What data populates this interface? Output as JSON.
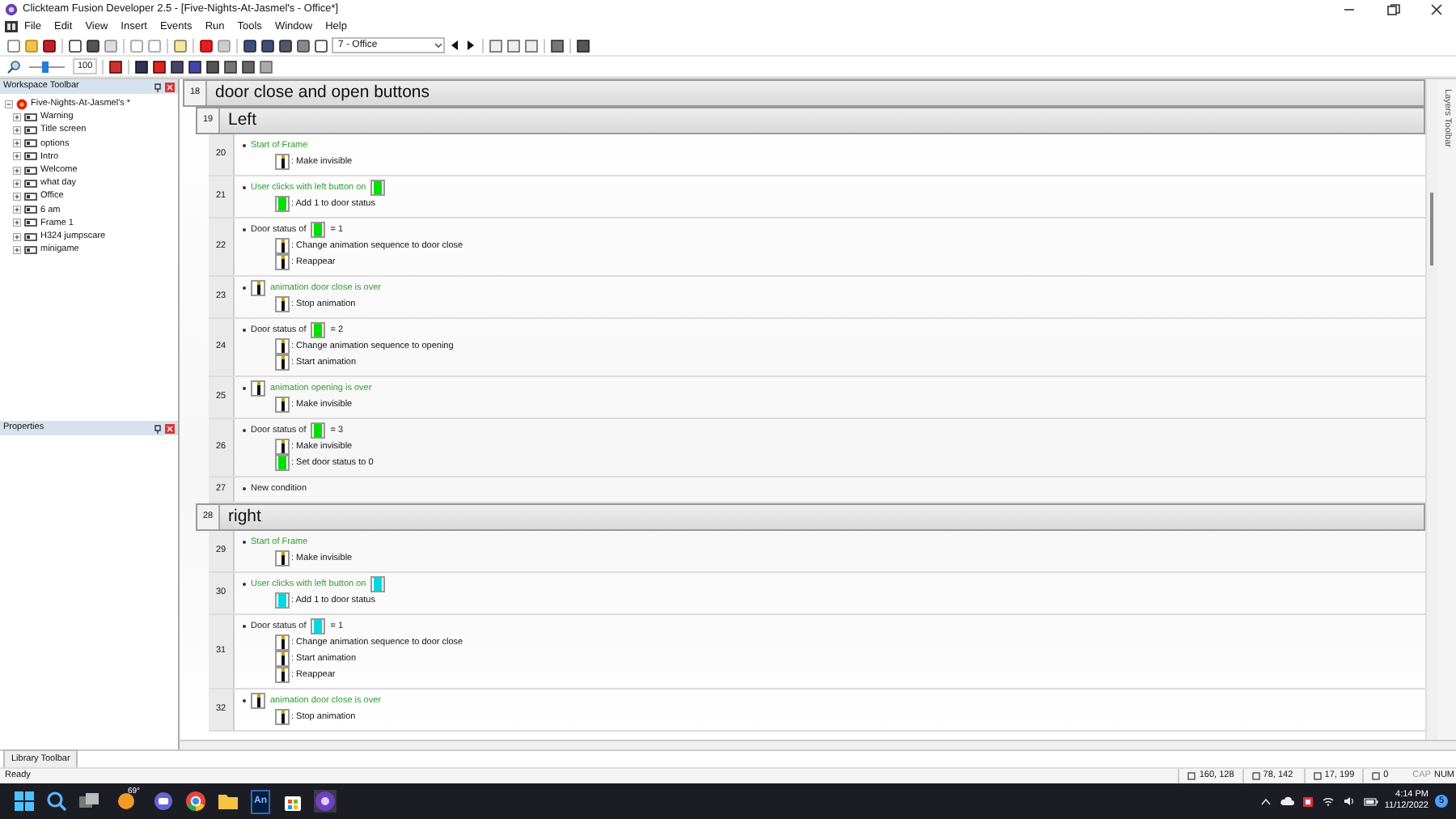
{
  "window": {
    "title": "Clickteam Fusion Developer 2.5 - [Five-Nights-At-Jasmel's - Office*]"
  },
  "menu": [
    "File",
    "Edit",
    "View",
    "Insert",
    "Events",
    "Run",
    "Tools",
    "Window",
    "Help"
  ],
  "toolbar": {
    "frame_select": "7 - Office",
    "zoom": "100",
    "slider": {
      "level": 0.45
    }
  },
  "workspace": {
    "title": "Workspace Toolbar",
    "project": {
      "label": "Five-Nights-At-Jasmel's *",
      "expanded": true,
      "children": [
        {
          "label": "Warning"
        },
        {
          "label": "Title screen"
        },
        {
          "label": "options"
        },
        {
          "label": "Intro"
        },
        {
          "label": "Welcome"
        },
        {
          "label": "what day"
        },
        {
          "label": "Office"
        },
        {
          "label": "6 am"
        },
        {
          "label": "Frame 1"
        },
        {
          "label": "H324 jumpscare"
        },
        {
          "label": "minigame"
        }
      ]
    }
  },
  "properties": {
    "title": "Properties"
  },
  "events": [
    {
      "kind": "group",
      "number": "18",
      "title": "door close and open buttons",
      "children": [
        {
          "kind": "group",
          "number": "19",
          "title": "Left",
          "children": [
            {
              "kind": "event",
              "number": "20",
              "condition": {
                "color": "#2e9e2e",
                "parts": [
                  {
                    "kind": "text",
                    "text": "Start of Frame"
                  }
                ]
              },
              "actions": [
                {
                  "kind": "door",
                  "text": ": Make invisible"
                }
              ]
            },
            {
              "kind": "event",
              "number": "21",
              "condition": {
                "color": "#2e9e2e",
                "parts": [
                  {
                    "kind": "text",
                    "text": "User clicks with left button on"
                  },
                  {
                    "kind": "button",
                    "color": "#00e000"
                  }
                ]
              },
              "actions": [
                {
                  "kind": "button",
                  "color": "#00e000",
                  "text": ": Add 1 to door status"
                }
              ]
            },
            {
              "kind": "event",
              "number": "22",
              "condition": {
                "color": "#222222",
                "parts": [
                  {
                    "kind": "text",
                    "text": "Door status of"
                  },
                  {
                    "kind": "button",
                    "color": "#00e000"
                  },
                  {
                    "kind": "text",
                    "text": "= 1"
                  }
                ]
              },
              "actions": [
                {
                  "kind": "door",
                  "text": ": Change animation sequence to door close"
                },
                {
                  "kind": "door",
                  "text": ": Reappear"
                }
              ]
            },
            {
              "kind": "event",
              "number": "23",
              "condition": {
                "color": "#2e9e2e",
                "parts": [
                  {
                    "kind": "door"
                  },
                  {
                    "kind": "text",
                    "text": "animation door close is over"
                  }
                ]
              },
              "actions": [
                {
                  "kind": "door",
                  "text": ": Stop animation"
                }
              ]
            },
            {
              "kind": "event",
              "number": "24",
              "condition": {
                "color": "#222222",
                "parts": [
                  {
                    "kind": "text",
                    "text": "Door status of"
                  },
                  {
                    "kind": "button",
                    "color": "#00e000"
                  },
                  {
                    "kind": "text",
                    "text": "= 2"
                  }
                ]
              },
              "actions": [
                {
                  "kind": "door",
                  "text": ": Change animation sequence to opening"
                },
                {
                  "kind": "door",
                  "text": ": Start animation"
                }
              ]
            },
            {
              "kind": "event",
              "number": "25",
              "condition": {
                "color": "#2e9e2e",
                "parts": [
                  {
                    "kind": "door"
                  },
                  {
                    "kind": "text",
                    "text": "animation opening is over"
                  }
                ]
              },
              "actions": [
                {
                  "kind": "door",
                  "text": ": Make invisible"
                }
              ]
            },
            {
              "kind": "event",
              "number": "26",
              "condition": {
                "color": "#222222",
                "parts": [
                  {
                    "kind": "text",
                    "text": "Door status of"
                  },
                  {
                    "kind": "button",
                    "color": "#00e000"
                  },
                  {
                    "kind": "text",
                    "text": "= 3"
                  }
                ]
              },
              "actions": [
                {
                  "kind": "door",
                  "text": ": Make invisible"
                },
                {
                  "kind": "button",
                  "color": "#00e000",
                  "text": ": Set door status to 0"
                }
              ]
            },
            {
              "kind": "event",
              "number": "27",
              "condition": {
                "color": "#222222",
                "parts": [
                  {
                    "kind": "text",
                    "text": "New condition"
                  }
                ]
              }
            }
          ]
        },
        {
          "kind": "group",
          "number": "28",
          "title": "right",
          "children": [
            {
              "kind": "event",
              "number": "29",
              "condition": {
                "color": "#2e9e2e",
                "parts": [
                  {
                    "kind": "text",
                    "text": "Start of Frame"
                  }
                ]
              },
              "actions": [
                {
                  "kind": "door",
                  "text": ": Make invisible"
                }
              ]
            },
            {
              "kind": "event",
              "number": "30",
              "condition": {
                "color": "#2e9e2e",
                "parts": [
                  {
                    "kind": "text",
                    "text": "User clicks with left button on"
                  },
                  {
                    "kind": "button",
                    "color": "#00d8e0"
                  }
                ]
              },
              "actions": [
                {
                  "kind": "button",
                  "color": "#00d8e0",
                  "text": ": Add 1 to door status"
                }
              ]
            },
            {
              "kind": "event",
              "number": "31",
              "condition": {
                "color": "#222222",
                "parts": [
                  {
                    "kind": "text",
                    "text": "Door status of"
                  },
                  {
                    "kind": "button",
                    "color": "#00d8e0"
                  },
                  {
                    "kind": "text",
                    "text": "= 1"
                  }
                ]
              },
              "actions": [
                {
                  "kind": "door",
                  "text": ": Change animation sequence to door close"
                },
                {
                  "kind": "door",
                  "text": ": Start animation"
                },
                {
                  "kind": "door",
                  "text": ": Reappear"
                }
              ]
            },
            {
              "kind": "event",
              "number": "32",
              "condition": {
                "color": "#2e9e2e",
                "parts": [
                  {
                    "kind": "door"
                  },
                  {
                    "kind": "text",
                    "text": "animation door close is over"
                  }
                ]
              },
              "actions": [
                {
                  "kind": "door",
                  "text": ": Stop animation"
                }
              ]
            }
          ]
        }
      ]
    }
  ],
  "layers_toolbar": {
    "title": "Layers Toolbar"
  },
  "library_toolbar": {
    "title": "Library Toolbar"
  },
  "status_bar": {
    "text": "Ready",
    "fields": [
      "160, 128",
      "78, 142",
      "17, 199",
      "0"
    ],
    "keys": [
      {
        "label": "CAP",
        "on": false
      },
      {
        "label": "NUM",
        "on": true
      }
    ]
  },
  "taskbar": {
    "weather": "69°",
    "apps": [
      {
        "kind": "start"
      },
      {
        "kind": "search"
      },
      {
        "kind": "taskview"
      },
      {
        "kind": "weather"
      },
      {
        "kind": "chat"
      },
      {
        "kind": "chrome"
      },
      {
        "kind": "folder"
      },
      {
        "kind": "animate",
        "label": "An"
      },
      {
        "kind": "store"
      },
      {
        "kind": "fusion",
        "selected": true
      }
    ],
    "time": "4:14 PM",
    "date": "11/12/2022",
    "badge": "5"
  }
}
